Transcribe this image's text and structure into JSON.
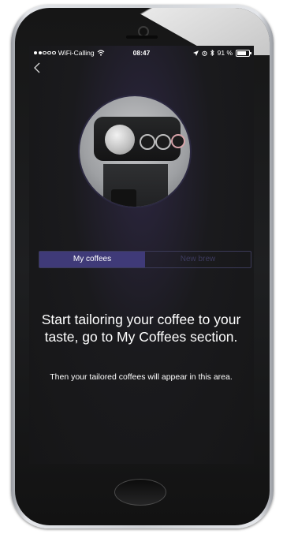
{
  "status_bar": {
    "carrier": "WiFi-Calling",
    "time": "08:47",
    "battery": "91 %",
    "battery_level": 0.91
  },
  "nav": {
    "back_icon": "chevron-left-icon"
  },
  "hero": {
    "image": "coffee-machine-illustration"
  },
  "tabs": [
    {
      "label": "My coffees",
      "active": true
    },
    {
      "label": "New brew",
      "active": false
    }
  ],
  "empty_state": {
    "headline": "Start tailoring your coffee to your taste, go to My Coffees section.",
    "subline": "Then your tailored coffees will appear in this area."
  },
  "colors": {
    "accent": "#3f3a78",
    "background": "#1a1a1d",
    "text": "#ffffff"
  }
}
